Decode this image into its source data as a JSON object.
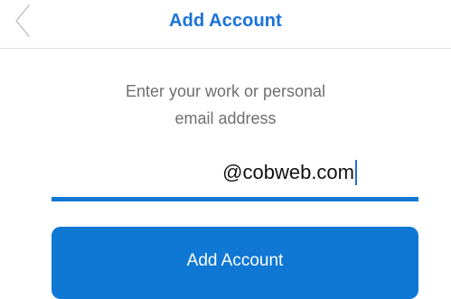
{
  "header": {
    "back_icon": "chevron-left-icon",
    "title": "Add Account"
  },
  "instructions": {
    "line1": "Enter your work or personal",
    "line2": "email address"
  },
  "email": {
    "value": "@cobweb.com"
  },
  "primary_button": {
    "label": "Add Account"
  },
  "colors": {
    "accent": "#0f78d4",
    "title": "#1a73d9",
    "instructions_text": "#6f6f6f",
    "back_icon": "#c6c6cc"
  }
}
